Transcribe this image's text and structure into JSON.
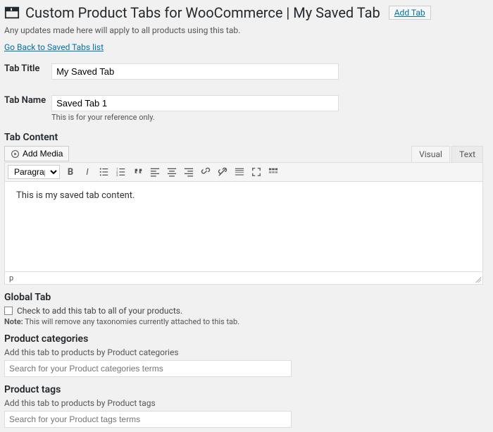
{
  "header": {
    "title": "Custom Product Tabs for WooCommerce | My Saved Tab",
    "add_tab_label": "Add Tab"
  },
  "sub_notice": "Any updates made here will apply to all products using this tab.",
  "back_link": "Go Back to Saved Tabs list",
  "form": {
    "tab_title_label": "Tab Title",
    "tab_title_value": "My Saved Tab",
    "tab_name_label": "Tab Name",
    "tab_name_value": "Saved Tab 1",
    "tab_name_help": "This is for your reference only."
  },
  "content": {
    "heading": "Tab Content",
    "add_media_label": "Add Media",
    "tabs": {
      "visual": "Visual",
      "text": "Text"
    },
    "format_label": "Paragraph",
    "body": "This is my saved tab content.",
    "status_path": "p"
  },
  "global_tab": {
    "heading": "Global Tab",
    "checkbox_label": "Check to add this tab to all of your products.",
    "note_prefix": "Note:",
    "note_text": " This will remove any taxonomies currently attached to this tab."
  },
  "categories": {
    "heading": "Product categories",
    "desc": "Add this tab to products by Product categories",
    "placeholder": "Search for your Product categories terms"
  },
  "tags": {
    "heading": "Product tags",
    "desc": "Add this tab to products by Product tags",
    "placeholder": "Search for your Product tags terms"
  }
}
